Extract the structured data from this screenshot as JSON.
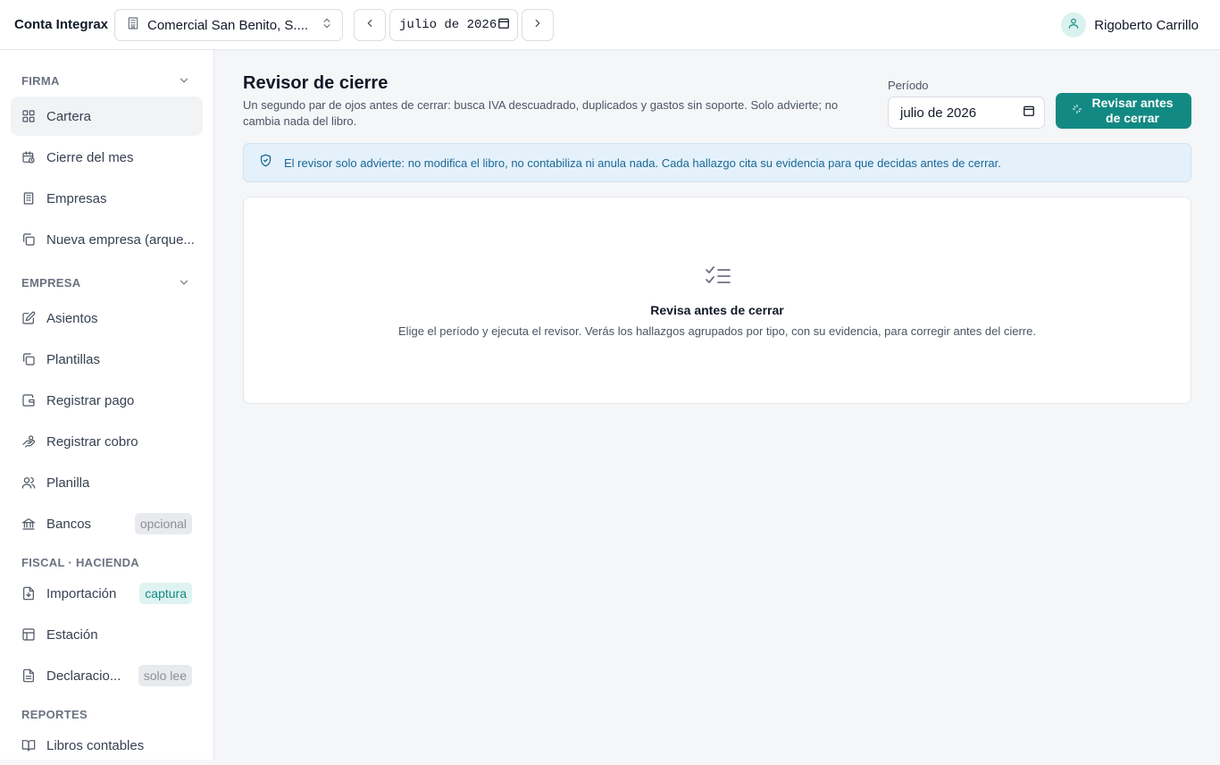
{
  "app": {
    "brand": "Conta Integrax"
  },
  "header": {
    "company": "Comercial San Benito, S....",
    "period": "julio de 2026",
    "user": "Rigoberto Carrillo"
  },
  "sidebar": {
    "sections": [
      {
        "label": "FIRMA"
      },
      {
        "label": "EMPRESA"
      },
      {
        "label": "FISCAL · HACIENDA"
      },
      {
        "label": "REPORTES"
      }
    ],
    "items": [
      {
        "label": "Cartera",
        "icon": "grid-icon"
      },
      {
        "label": "Cierre del mes",
        "icon": "calendar-clock-icon"
      },
      {
        "label": "Empresas",
        "icon": "building-icon"
      },
      {
        "label": "Nueva empresa (arque...",
        "icon": "copy-icon"
      },
      {
        "label": "Asientos",
        "icon": "edit-icon"
      },
      {
        "label": "Plantillas",
        "icon": "copy-icon"
      },
      {
        "label": "Registrar pago",
        "icon": "wallet-icon"
      },
      {
        "label": "Registrar cobro",
        "icon": "hand-coins-icon"
      },
      {
        "label": "Planilla",
        "icon": "users-icon"
      },
      {
        "label": "Bancos",
        "icon": "bank-icon",
        "badge": "opcional"
      },
      {
        "label": "Importación",
        "icon": "file-import-icon",
        "badge": "captura"
      },
      {
        "label": "Estación",
        "icon": "layout-icon"
      },
      {
        "label": "Declaracio...",
        "icon": "file-text-icon",
        "badge": "solo lee"
      },
      {
        "label": "Libros contables",
        "icon": "book-icon"
      }
    ]
  },
  "main": {
    "title": "Revisor de cierre",
    "subtitle": "Un segundo par de ojos antes de cerrar: busca IVA descuadrado, duplicados y gastos sin soporte. Solo advierte; no cambia nada del libro.",
    "period_label": "Período",
    "period_value": "julio de 2026",
    "run_button": "Revisar antes de cerrar",
    "notice": "El revisor solo advierte: no modifica el libro, no contabiliza ni anula nada. Cada hallazgo cita su evidencia para que decidas antes de cerrar.",
    "empty_title": "Revisa antes de cerrar",
    "empty_desc": "Elige el período y ejecuta el revisor. Verás los hallazgos agrupados por tipo, con su evidencia, para corregir antes del cierre."
  },
  "colors": {
    "accent": "#128a83",
    "notice_bg": "#e4f1fb",
    "notice_text": "#1a6896"
  }
}
